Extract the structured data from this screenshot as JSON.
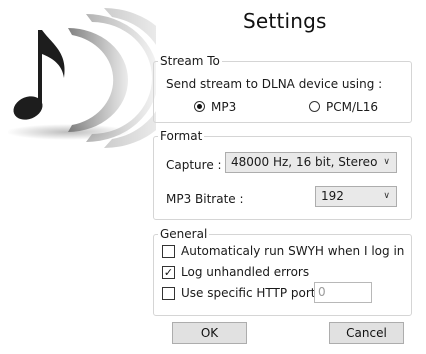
{
  "window": {
    "title": "Settings"
  },
  "stream_to": {
    "legend": "Stream To",
    "prompt": "Send stream to DLNA device using :",
    "options": [
      {
        "label": "MP3",
        "selected": true
      },
      {
        "label": "PCM/L16",
        "selected": false
      }
    ]
  },
  "format": {
    "legend": "Format",
    "capture_label": "Capture :",
    "capture_value": "48000 Hz, 16 bit, Stereo",
    "bitrate_label": "MP3 Bitrate :",
    "bitrate_value": "192"
  },
  "general": {
    "legend": "General",
    "auto_run": {
      "label": "Automaticaly run SWYH when I log in",
      "checked": false
    },
    "log_errors": {
      "label": "Log unhandled errors",
      "checked": true
    },
    "http_port": {
      "label": "Use specific HTTP port :",
      "checked": false,
      "value": "0"
    }
  },
  "buttons": {
    "ok": "OK",
    "cancel": "Cancel"
  },
  "icons": {
    "logo": "music-note-sound-waves-icon",
    "dropdown": "chevron-down-icon",
    "check": "checkmark-icon"
  }
}
